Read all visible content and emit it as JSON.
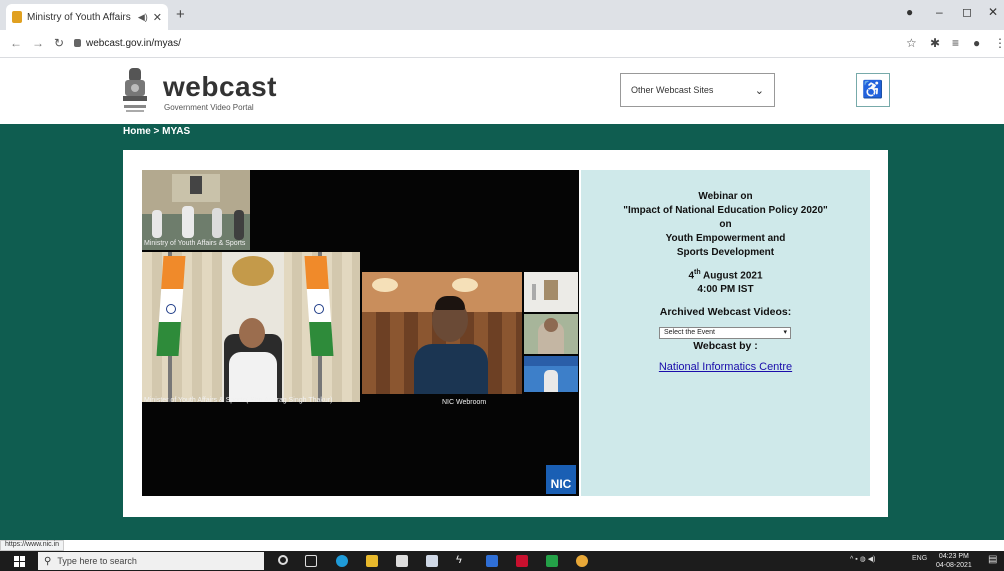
{
  "browser": {
    "tab_title": "Ministry of Youth Affairs and",
    "tab_audio_icon": "speaker-icon",
    "url": "webcast.gov.in/myas/"
  },
  "site": {
    "logo_word": "webcast",
    "logo_sub": "Government Video Portal",
    "sites_select": "Other Webcast Sites",
    "accessibility_icon": "wheelchair-icon"
  },
  "breadcrumb": "Home > MYAS",
  "video": {
    "tile_top_label": "Ministry of Youth Affairs & Sports",
    "tile_minister_label": "Minister of Youth Affairs & Sports( Shri Anurag Singh Thakur)",
    "tile_nic_label": "NIC Webroom",
    "nic_logo": "NIC"
  },
  "info": {
    "line1": "Webinar on",
    "line2": "\"Impact of National Education Policy 2020\"",
    "line3": "on",
    "line4": "Youth Empowerment and",
    "line5": "Sports Development",
    "date_day": "4",
    "date_sup": "th",
    "date_rest": " August 2021",
    "time": "4:00 PM IST",
    "archived_label": "Archived Webcast Videos:",
    "event_select": "Select the Event",
    "webcast_by": "Webcast by :",
    "nic_link": "National Informatics Centre"
  },
  "status_url": "https://www.nic.in",
  "taskbar": {
    "search_placeholder": "Type here to search",
    "tray_lang": "ENG",
    "time": "04:23 PM",
    "date": "04-08-2021"
  },
  "colors": {
    "teal": "#0f5d50",
    "panel": "#cfe9ea",
    "link": "#1a0dab"
  }
}
